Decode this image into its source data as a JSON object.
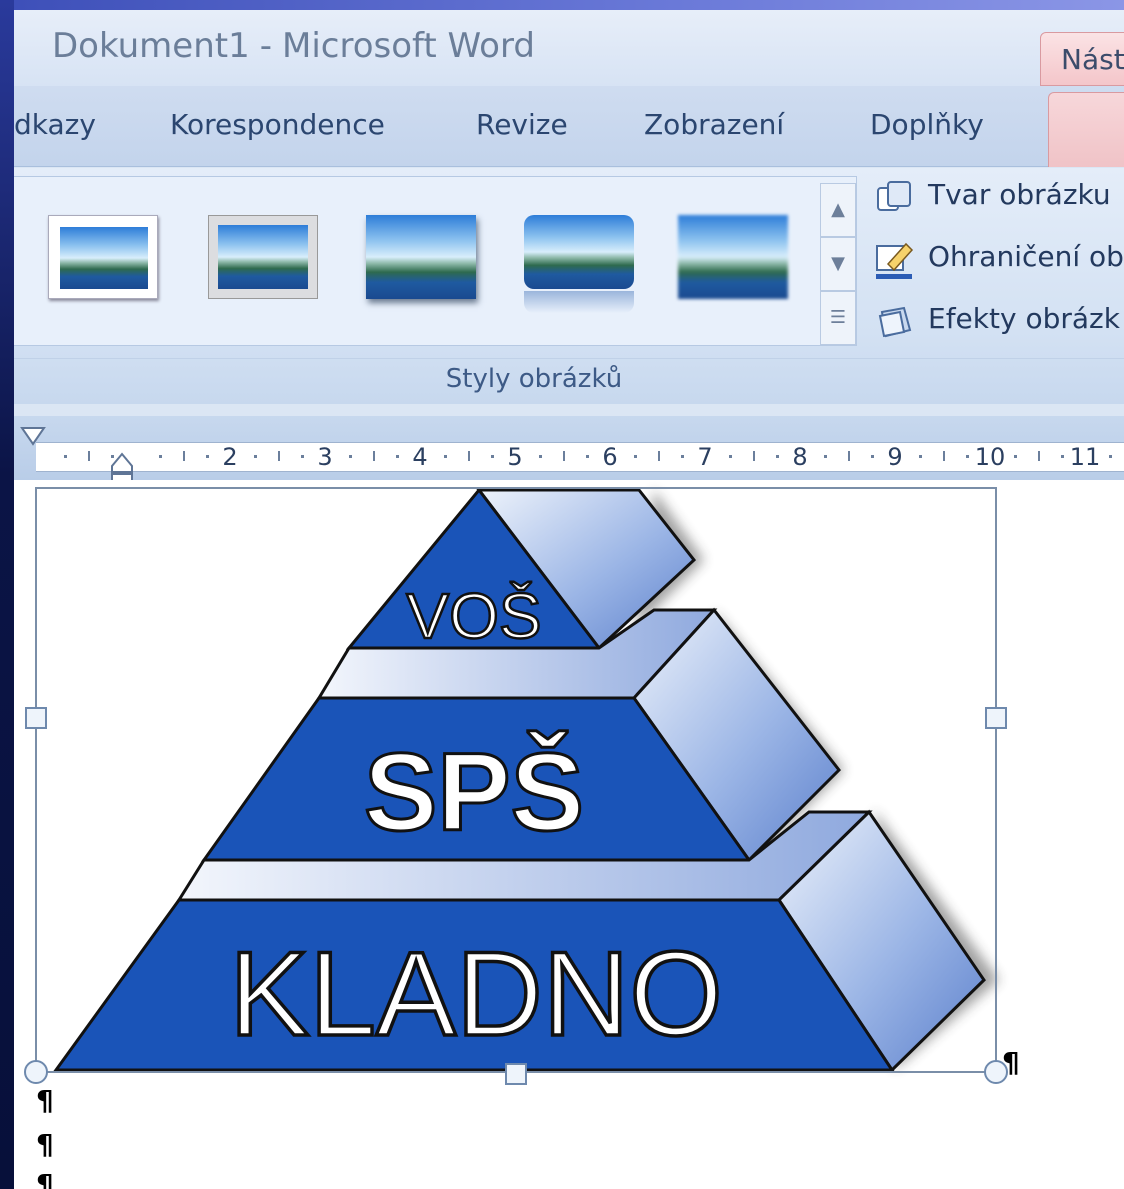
{
  "window": {
    "doc_name": "Dokument1",
    "separator": "-",
    "app_name": "Microsoft Word",
    "context_tab": "Nást"
  },
  "tabs": [
    {
      "label": "dkazy"
    },
    {
      "label": "Korespondence"
    },
    {
      "label": "Revize"
    },
    {
      "label": "Zobrazení"
    },
    {
      "label": "Doplňky"
    }
  ],
  "ribbon": {
    "group_label": "Styly obrázků",
    "gallery_items": [
      "simple-white-frame",
      "beveled-matte",
      "drop-shadow",
      "reflected-rounded",
      "soft-edge"
    ],
    "commands": [
      {
        "label": "Tvar obrázku",
        "icon": "shape-icon"
      },
      {
        "label": "Ohraničení ob",
        "icon": "border-pencil-icon"
      },
      {
        "label": "Efekty obrázk",
        "icon": "effects-icon"
      }
    ]
  },
  "ruler": {
    "numbers": [
      "2",
      "3",
      "4",
      "5",
      "6",
      "7",
      "8",
      "9",
      "10",
      "11"
    ]
  },
  "logo": {
    "top_text": "VOŠ",
    "middle_text": "SPŠ",
    "bottom_text": "KLADNO"
  },
  "colors": {
    "logo_blue": "#1a54b8",
    "logo_side": "#6f92d6",
    "context_tab": "#f4c6ca"
  }
}
